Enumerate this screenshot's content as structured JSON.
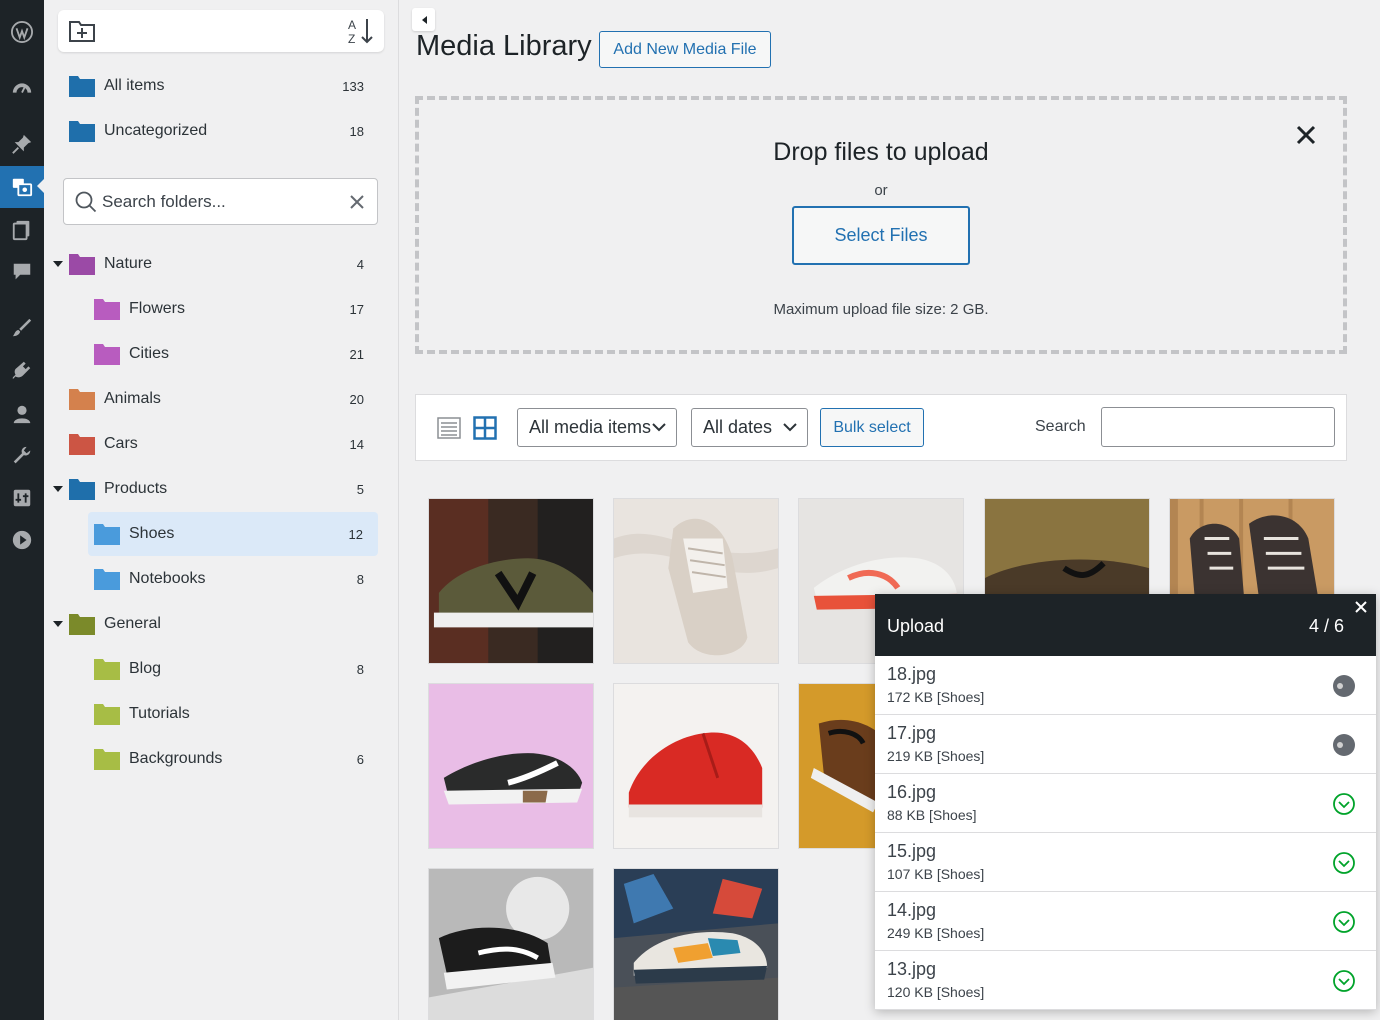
{
  "admin_menu": [
    {
      "icon": "wordpress-logo-icon"
    },
    {
      "icon": "dashboard-icon"
    },
    {
      "icon": "pin-icon"
    },
    {
      "icon": "media-icon",
      "active": true
    },
    {
      "icon": "pages-icon"
    },
    {
      "icon": "comments-icon"
    },
    {
      "icon": "appearance-icon"
    },
    {
      "icon": "plugins-icon"
    },
    {
      "icon": "users-icon"
    },
    {
      "icon": "tools-icon"
    },
    {
      "icon": "settings-icon"
    },
    {
      "icon": "play-icon"
    }
  ],
  "folders": {
    "top": [
      {
        "label": "All items",
        "count": "133"
      },
      {
        "label": "Uncategorized",
        "count": "18"
      }
    ],
    "search_placeholder": "Search folders...",
    "tree": [
      {
        "label": "Nature",
        "count": "4",
        "color": "#9b4aa6"
      },
      {
        "label": "Flowers",
        "count": "17",
        "color": "#b85cbf"
      },
      {
        "label": "Cities",
        "count": "21",
        "color": "#b85cbf"
      },
      {
        "label": "Animals",
        "count": "20",
        "color": "#d4814d"
      },
      {
        "label": "Cars",
        "count": "14",
        "color": "#cc5544"
      },
      {
        "label": "Products",
        "count": "5",
        "color": "#1f6fab"
      },
      {
        "label": "Shoes",
        "count": "12",
        "color": "#4a9bdc"
      },
      {
        "label": "Notebooks",
        "count": "8",
        "color": "#4a9bdc"
      },
      {
        "label": "General",
        "count": "",
        "color": "#7b8a2a"
      },
      {
        "label": "Blog",
        "count": "8",
        "color": "#a7bd45"
      },
      {
        "label": "Tutorials",
        "count": "",
        "color": "#a7bd45"
      },
      {
        "label": "Backgrounds",
        "count": "6",
        "color": "#a7bd45"
      }
    ]
  },
  "main": {
    "title": "Media Library",
    "add_new_label": "Add New Media File",
    "dropzone": {
      "title": "Drop files to upload",
      "or": "or",
      "select_label": "Select Files",
      "max_size": "Maximum upload file size: 2 GB."
    },
    "filters": {
      "type_selected": "All media items",
      "date_selected": "All dates",
      "bulk_label": "Bulk select",
      "search_label": "Search"
    }
  },
  "upload": {
    "title": "Upload",
    "count": "4 / 6",
    "items": [
      {
        "name": "18.jpg",
        "meta": "172 KB [Shoes]",
        "status": "pending"
      },
      {
        "name": "17.jpg",
        "meta": "219 KB [Shoes]",
        "status": "pending"
      },
      {
        "name": "16.jpg",
        "meta": "88 KB [Shoes]",
        "status": "done"
      },
      {
        "name": "15.jpg",
        "meta": "107 KB [Shoes]",
        "status": "done"
      },
      {
        "name": "14.jpg",
        "meta": "249 KB [Shoes]",
        "status": "done"
      },
      {
        "name": "13.jpg",
        "meta": "120 KB [Shoes]",
        "status": "done"
      }
    ]
  },
  "colors": {
    "accent": "#2271b1",
    "success": "#00a32a",
    "admin_bg": "#1d2327"
  }
}
